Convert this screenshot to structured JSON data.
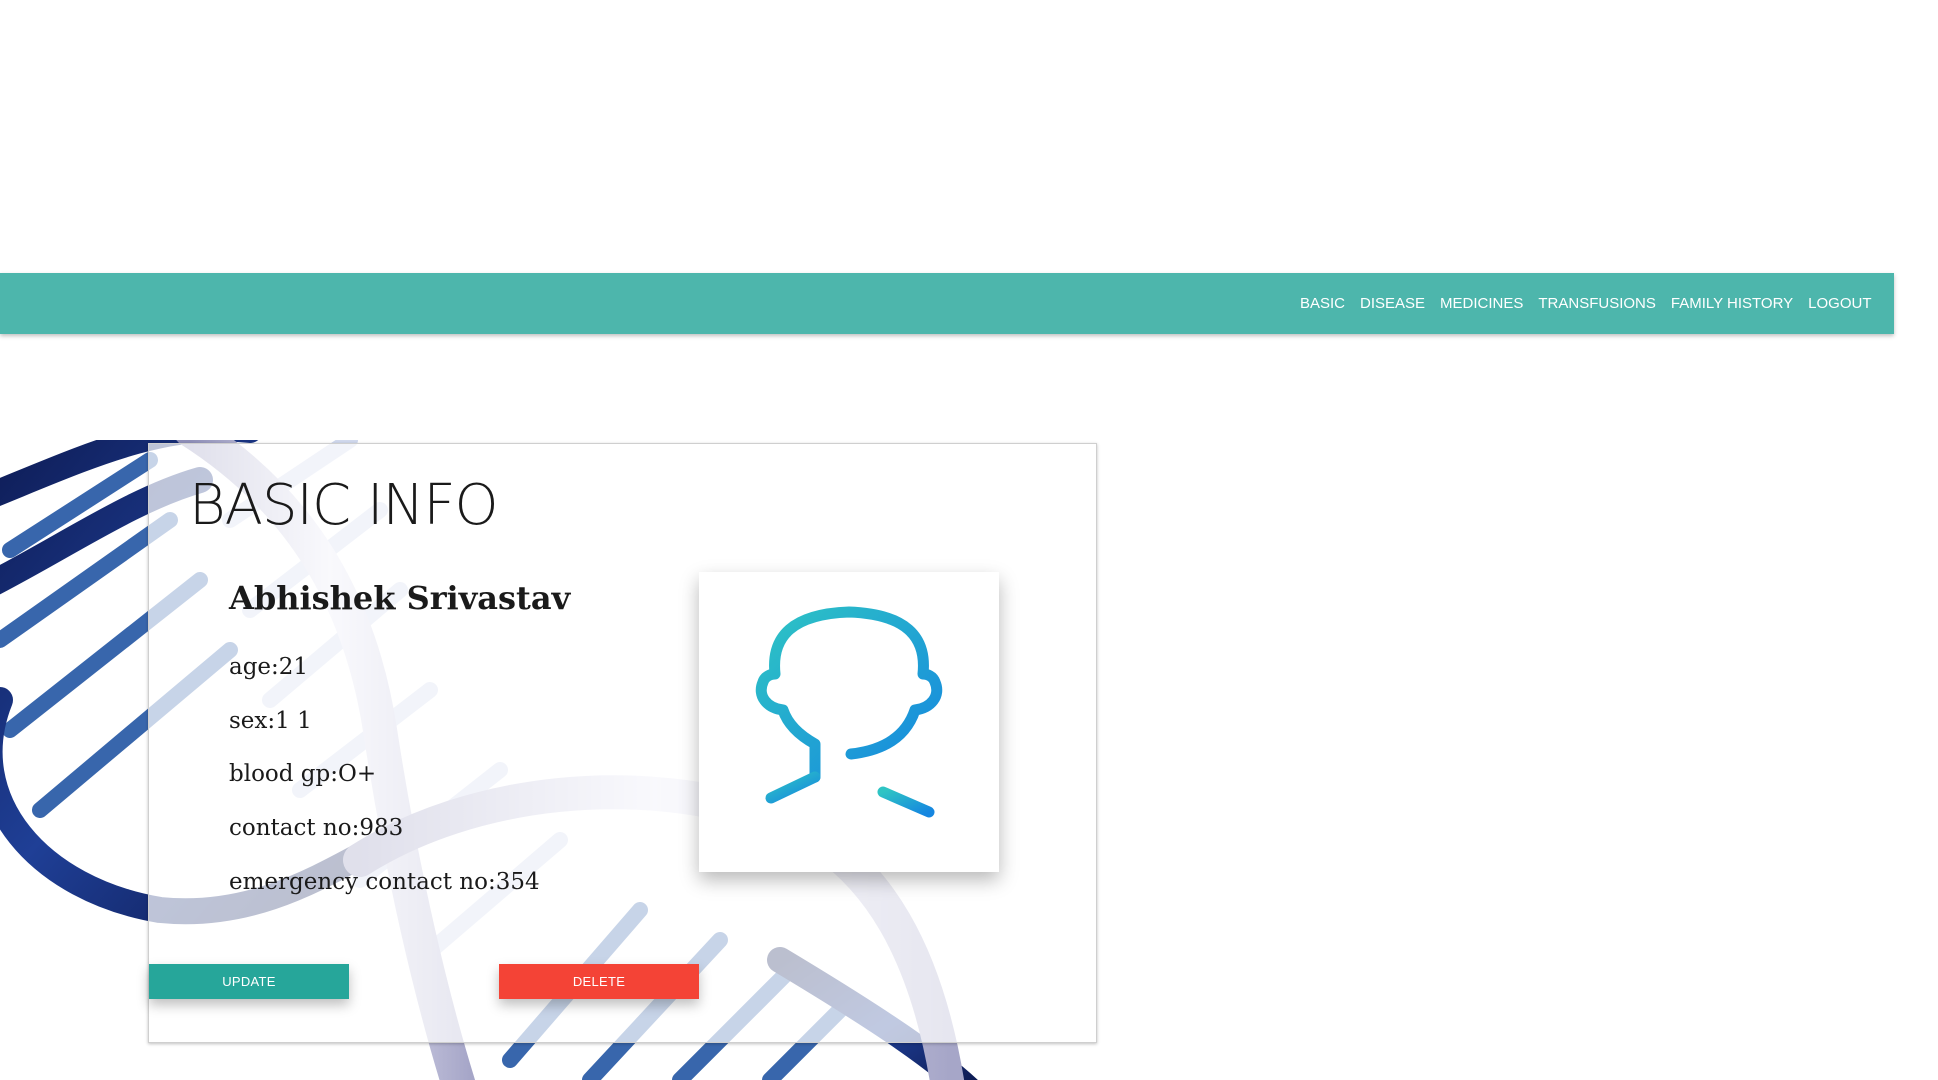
{
  "nav": {
    "items": [
      {
        "label": "BASIC"
      },
      {
        "label": "DISEASE"
      },
      {
        "label": "MEDICINES"
      },
      {
        "label": "TRANSFUSIONS"
      },
      {
        "label": "FAMILY HISTORY"
      },
      {
        "label": "LOGOUT"
      }
    ]
  },
  "card": {
    "title": "BASIC INFO",
    "name": "Abhishek Srivastav",
    "fields": {
      "age": "age:21",
      "sex": "sex:1 1",
      "blood_group": "blood gp:O+",
      "contact": "contact no:983",
      "emergency_contact": "emergency contact no:354"
    },
    "avatar_icon": "user-profile-icon",
    "buttons": {
      "update": "UPDATE",
      "delete": "DELETE"
    }
  },
  "colors": {
    "navbar": "#4db6ac",
    "update_button": "#26a69a",
    "delete_button": "#f44336",
    "avatar_gradient_start": "#2ec4c4",
    "avatar_gradient_end": "#1586e0"
  }
}
